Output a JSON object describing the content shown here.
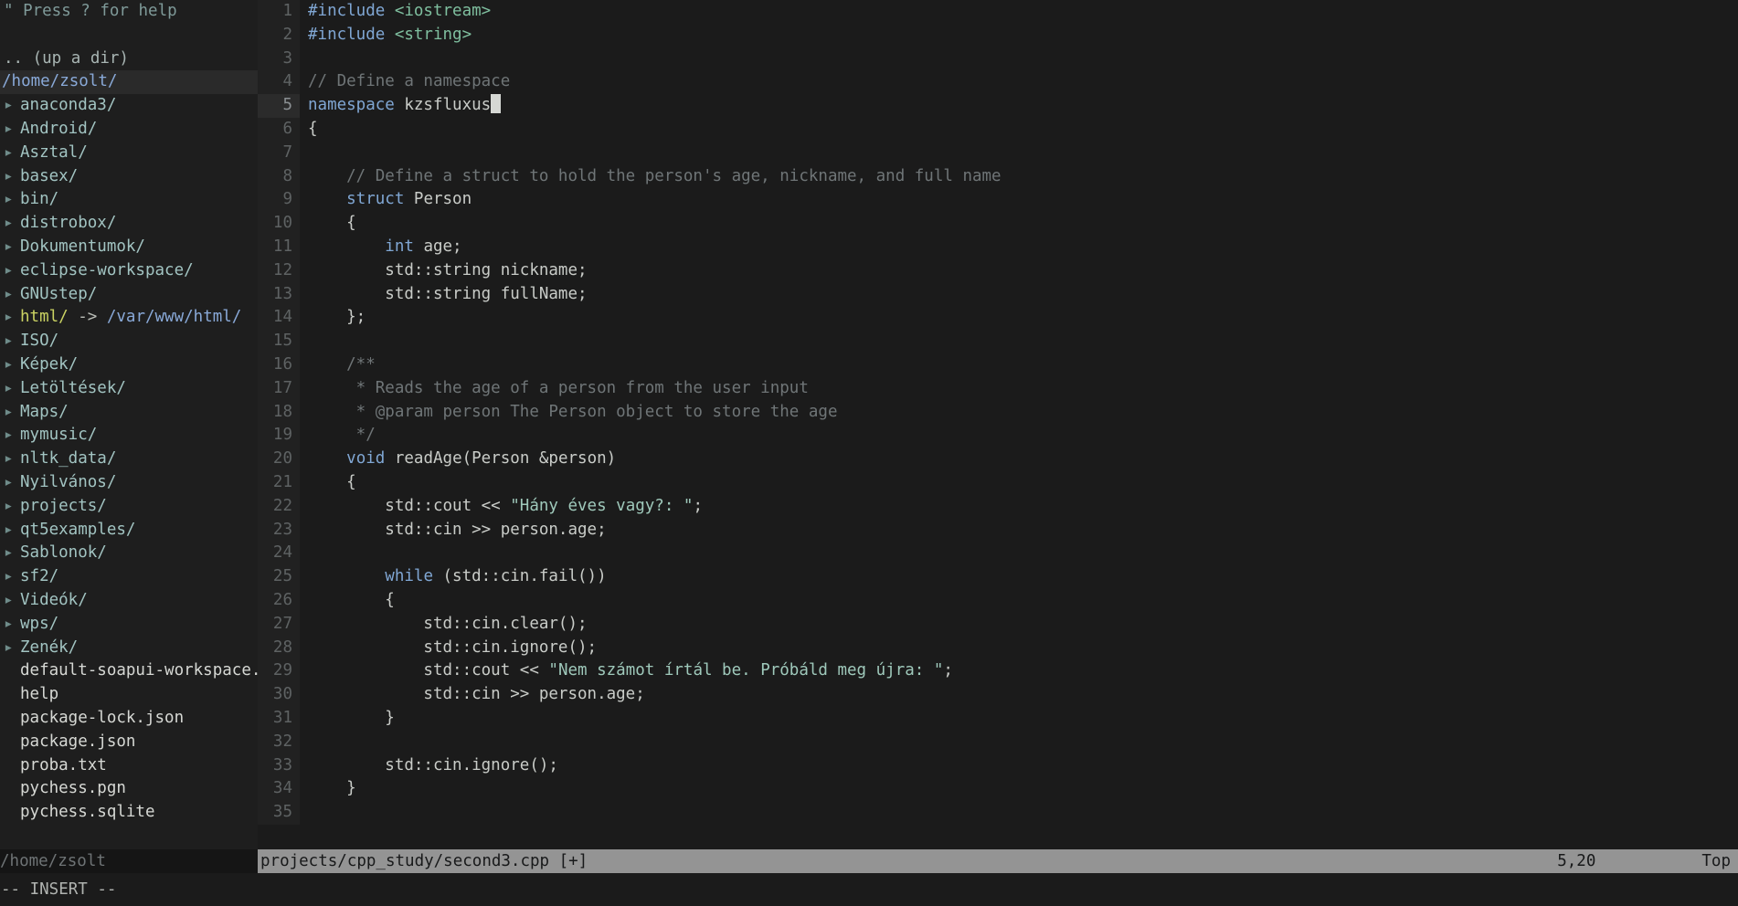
{
  "app": {
    "name": "vim",
    "mode_line": "-- INSERT --"
  },
  "explorer": {
    "help_hint": "\" Press ? for help",
    "up_a_dir": ".. (up a dir)",
    "cwd": "/home/zsolt/",
    "arrow_glyph": "▸",
    "items": [
      {
        "kind": "dir",
        "label": "anaconda3/"
      },
      {
        "kind": "dir",
        "label": "Android/"
      },
      {
        "kind": "dir",
        "label": "Asztal/"
      },
      {
        "kind": "dir",
        "label": "basex/"
      },
      {
        "kind": "dir",
        "label": "bin/"
      },
      {
        "kind": "dir",
        "label": "distrobox/"
      },
      {
        "kind": "dir",
        "label": "Dokumentumok/"
      },
      {
        "kind": "dir",
        "label": "eclipse-workspace/"
      },
      {
        "kind": "dir",
        "label": "GNUstep/"
      },
      {
        "kind": "link",
        "label": "html/",
        "link_arrow": " -> ",
        "target": "/var/www/html/"
      },
      {
        "kind": "dir",
        "label": "ISO/"
      },
      {
        "kind": "dir",
        "label": "Képek/"
      },
      {
        "kind": "dir",
        "label": "Letöltések/"
      },
      {
        "kind": "dir",
        "label": "Maps/"
      },
      {
        "kind": "dir",
        "label": "mymusic/"
      },
      {
        "kind": "dir",
        "label": "nltk_data/"
      },
      {
        "kind": "dir",
        "label": "Nyilvános/"
      },
      {
        "kind": "dir",
        "label": "projects/"
      },
      {
        "kind": "dir",
        "label": "qt5examples/"
      },
      {
        "kind": "dir",
        "label": "Sablonok/"
      },
      {
        "kind": "dir",
        "label": "sf2/"
      },
      {
        "kind": "dir",
        "label": "Videók/"
      },
      {
        "kind": "dir",
        "label": "wps/"
      },
      {
        "kind": "dir",
        "label": "Zenék/"
      },
      {
        "kind": "file",
        "label": "default-soapui-workspace.xml"
      },
      {
        "kind": "file",
        "label": "help"
      },
      {
        "kind": "file",
        "label": "package-lock.json"
      },
      {
        "kind": "file",
        "label": "package.json"
      },
      {
        "kind": "file",
        "label": "proba.txt"
      },
      {
        "kind": "file",
        "label": "pychess.pgn"
      },
      {
        "kind": "file",
        "label": "pychess.sqlite"
      }
    ],
    "status": "/home/zsolt"
  },
  "editor": {
    "status": {
      "filename": "projects/cpp_study/second3.cpp [+]",
      "position": "5,20",
      "scroll": "Top"
    },
    "cursor": {
      "line": 5,
      "col": 20
    },
    "lines": [
      {
        "n": 1,
        "tokens": [
          {
            "t": "pre",
            "s": "#include "
          },
          {
            "t": "inc",
            "s": "<iostream>"
          }
        ]
      },
      {
        "n": 2,
        "tokens": [
          {
            "t": "pre",
            "s": "#include "
          },
          {
            "t": "inc",
            "s": "<string>"
          }
        ]
      },
      {
        "n": 3,
        "tokens": []
      },
      {
        "n": 4,
        "tokens": [
          {
            "t": "cmt",
            "s": "// Define a namespace"
          }
        ]
      },
      {
        "n": 5,
        "tokens": [
          {
            "t": "kw",
            "s": "namespace"
          },
          {
            "t": "pln",
            "s": " kzsfluxus"
          }
        ],
        "cursor_at_end": true
      },
      {
        "n": 6,
        "tokens": [
          {
            "t": "pln",
            "s": "{"
          }
        ]
      },
      {
        "n": 7,
        "tokens": []
      },
      {
        "n": 8,
        "tokens": [
          {
            "t": "cmt",
            "s": "    // Define a struct to hold the person's age, nickname, and full name"
          }
        ]
      },
      {
        "n": 9,
        "tokens": [
          {
            "t": "pln",
            "s": "    "
          },
          {
            "t": "kw",
            "s": "struct"
          },
          {
            "t": "pln",
            "s": " Person"
          }
        ]
      },
      {
        "n": 10,
        "tokens": [
          {
            "t": "pln",
            "s": "    {"
          }
        ]
      },
      {
        "n": 11,
        "tokens": [
          {
            "t": "pln",
            "s": "        "
          },
          {
            "t": "typ",
            "s": "int"
          },
          {
            "t": "pln",
            "s": " age;"
          }
        ]
      },
      {
        "n": 12,
        "tokens": [
          {
            "t": "pln",
            "s": "        std::string nickname;"
          }
        ]
      },
      {
        "n": 13,
        "tokens": [
          {
            "t": "pln",
            "s": "        std::string fullName;"
          }
        ]
      },
      {
        "n": 14,
        "tokens": [
          {
            "t": "pln",
            "s": "    };"
          }
        ]
      },
      {
        "n": 15,
        "tokens": []
      },
      {
        "n": 16,
        "tokens": [
          {
            "t": "cmt",
            "s": "    /**"
          }
        ]
      },
      {
        "n": 17,
        "tokens": [
          {
            "t": "cmt",
            "s": "     * Reads the age of a person from the user input"
          }
        ]
      },
      {
        "n": 18,
        "tokens": [
          {
            "t": "cmt",
            "s": "     * @param person The Person object to store the age"
          }
        ]
      },
      {
        "n": 19,
        "tokens": [
          {
            "t": "cmt",
            "s": "     */"
          }
        ]
      },
      {
        "n": 20,
        "tokens": [
          {
            "t": "pln",
            "s": "    "
          },
          {
            "t": "typ",
            "s": "void"
          },
          {
            "t": "pln",
            "s": " readAge(Person &person)"
          }
        ]
      },
      {
        "n": 21,
        "tokens": [
          {
            "t": "pln",
            "s": "    {"
          }
        ]
      },
      {
        "n": 22,
        "tokens": [
          {
            "t": "pln",
            "s": "        std::cout << "
          },
          {
            "t": "str",
            "s": "\"Hány éves vagy?: \""
          },
          {
            "t": "pln",
            "s": ";"
          }
        ]
      },
      {
        "n": 23,
        "tokens": [
          {
            "t": "pln",
            "s": "        std::cin >> person.age;"
          }
        ]
      },
      {
        "n": 24,
        "tokens": []
      },
      {
        "n": 25,
        "tokens": [
          {
            "t": "pln",
            "s": "        "
          },
          {
            "t": "kw",
            "s": "while"
          },
          {
            "t": "pln",
            "s": " (std::cin.fail())"
          }
        ]
      },
      {
        "n": 26,
        "tokens": [
          {
            "t": "pln",
            "s": "        {"
          }
        ]
      },
      {
        "n": 27,
        "tokens": [
          {
            "t": "pln",
            "s": "            std::cin.clear();"
          }
        ]
      },
      {
        "n": 28,
        "tokens": [
          {
            "t": "pln",
            "s": "            std::cin.ignore();"
          }
        ]
      },
      {
        "n": 29,
        "tokens": [
          {
            "t": "pln",
            "s": "            std::cout << "
          },
          {
            "t": "str",
            "s": "\"Nem számot írtál be. Próbáld meg újra: \""
          },
          {
            "t": "pln",
            "s": ";"
          }
        ]
      },
      {
        "n": 30,
        "tokens": [
          {
            "t": "pln",
            "s": "            std::cin >> person.age;"
          }
        ]
      },
      {
        "n": 31,
        "tokens": [
          {
            "t": "pln",
            "s": "        }"
          }
        ]
      },
      {
        "n": 32,
        "tokens": []
      },
      {
        "n": 33,
        "tokens": [
          {
            "t": "pln",
            "s": "        std::cin.ignore();"
          }
        ]
      },
      {
        "n": 34,
        "tokens": [
          {
            "t": "pln",
            "s": "    }"
          }
        ]
      },
      {
        "n": 35,
        "tokens": []
      }
    ]
  },
  "colors": {
    "background": "#1b1b1b",
    "explorer_background": "#1e1e1e",
    "gutter_background": "#212121",
    "statusline_active": "#949494",
    "statusline_inactive": "#151515",
    "directory": "#a2c4c2",
    "file": "#d6d8d4",
    "symlink": "#cbd363",
    "keyword": "#80a7d4",
    "string": "#9fc9bb",
    "comment": "#6f7577",
    "include": "#7fbf9f",
    "cursor": "#d6d8d4"
  }
}
